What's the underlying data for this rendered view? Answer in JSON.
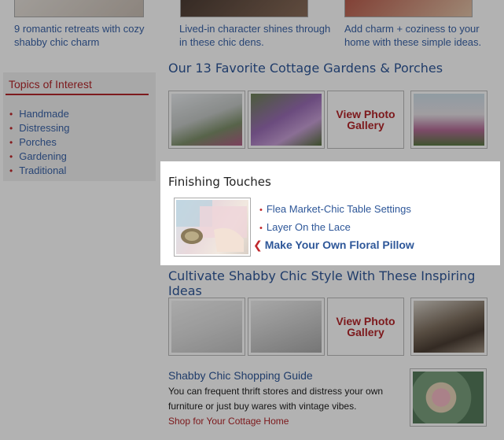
{
  "promos": [
    {
      "text": "9 romantic retreats with cozy shabby chic charm"
    },
    {
      "text": "Lived-in character shines through in these chic dens."
    },
    {
      "text": "Add charm + coziness to your home with these simple ideas."
    }
  ],
  "sidebar": {
    "heading": "Topics of Interest",
    "items": [
      {
        "label": "Handmade"
      },
      {
        "label": "Distressing"
      },
      {
        "label": "Porches"
      },
      {
        "label": "Gardening"
      },
      {
        "label": "Traditional"
      }
    ]
  },
  "cottage": {
    "title": "Our 13 Favorite Cottage Gardens & Porches",
    "gallery_line1": "View Photo",
    "gallery_line2": "Gallery"
  },
  "finishing": {
    "title": "Finishing Touches",
    "links": [
      {
        "label": "Flea Market-Chic Table Settings"
      },
      {
        "label": "Layer On the Lace"
      },
      {
        "label": "Make Your Own Floral Pillow"
      }
    ]
  },
  "cultivate": {
    "title": "Cultivate Shabby Chic Style With These Inspiring Ideas",
    "gallery_line1": "View Photo",
    "gallery_line2": "Gallery"
  },
  "shopping": {
    "title": "Shabby Chic Shopping Guide",
    "description": "You can frequent thrift stores and distress your own furniture or just buy wares with vintage vibes.",
    "link": "Shop for Your Cottage Home"
  },
  "colors": {
    "link_blue": "#2e5799",
    "accent_red": "#b3262a"
  }
}
